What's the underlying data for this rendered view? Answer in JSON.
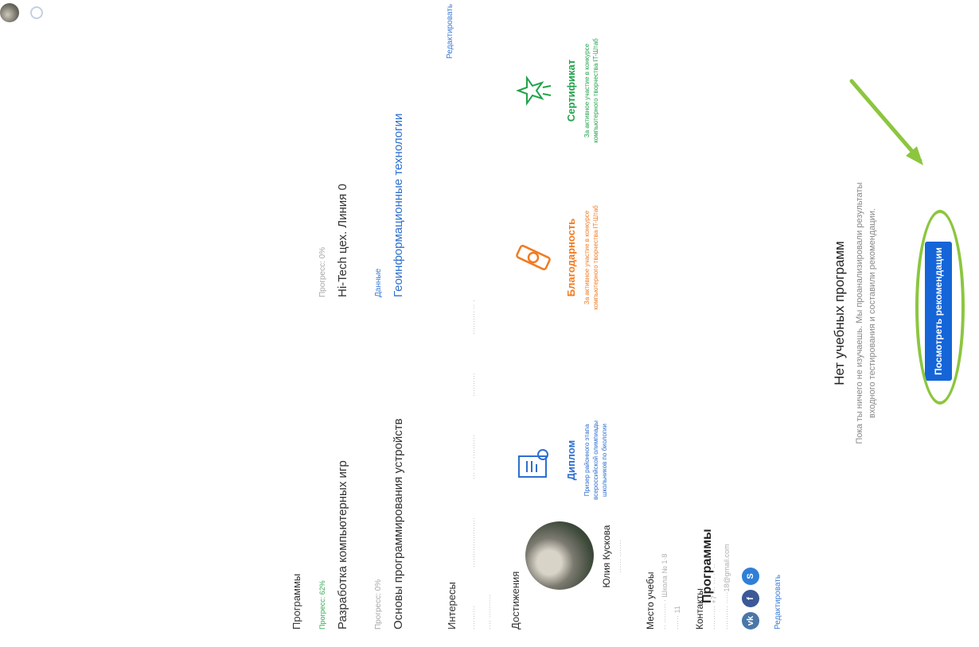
{
  "header": {
    "avatar_icon": "user-avatar",
    "status_icon": "ring-icon"
  },
  "profile": {
    "name": "Юлия Кускова",
    "subtitle": "······ ·······",
    "place_heading": "Место учебы",
    "place_line1": "·· ········ · Школа № 1·8",
    "place_line2": "······ 11",
    "contacts_heading": "Контакты",
    "contact_phone": "·········· +7 ··· ··· ·· ··",
    "contact_email": "·········· ·····18@gmail.com",
    "socials": [
      {
        "label": "vk",
        "color": "#4a76a8"
      },
      {
        "label": "f",
        "color": "#3b5998"
      },
      {
        "label": "S",
        "color": "#2f7fd8"
      }
    ],
    "edit_link": "Редактировать"
  },
  "programs": {
    "heading": "Программы",
    "items": [
      {
        "progress": "Прогресс: 62%",
        "title": "Разработка компьютерных игр",
        "meta": "Прогресс: 0%",
        "meta_title": "Hi-Tech цех. Линия 0"
      },
      {
        "progress": "Прогресс: 0%",
        "title": "Основы программирования устройств",
        "meta": "Данные",
        "meta_title": "Геоинформационные технологии"
      }
    ]
  },
  "interests": {
    "heading": "Интересы",
    "edit_link": "Редактировать",
    "tags": [
      "··········",
      "·····················",
      "··· ···· ··········",
      "··········",
      "·········· ·· ·"
    ],
    "tags2": [
      "···· ··········"
    ]
  },
  "achievements": {
    "heading": "Достижения",
    "items": [
      {
        "title": "Диплом",
        "desc": "Призер районного этапа всероссийской олимпиады школьников по биологии",
        "color": "#2d6fcf",
        "icon": "diploma-icon"
      },
      {
        "title": "Благодарность",
        "desc": "За активное участие в конкурсе компьютерного творчества IT-Штаб",
        "color": "#f07b22",
        "icon": "medal-icon"
      },
      {
        "title": "Сертификат",
        "desc": "За активное участие в конкурсе компьютерного творчества IT-Штаб",
        "color": "#21a34a",
        "icon": "star-certificate-icon"
      }
    ]
  },
  "bottom": {
    "programs_heading": "Программы",
    "empty_title": "Нет учебных программ",
    "empty_desc": "Пока ты ничего не изучаешь. Мы проанализировали результаты входного тестирования и составили рекомендации.",
    "button_label": "Посмотреть рекомендации"
  },
  "annotation": {
    "color": "#8cc63f"
  }
}
